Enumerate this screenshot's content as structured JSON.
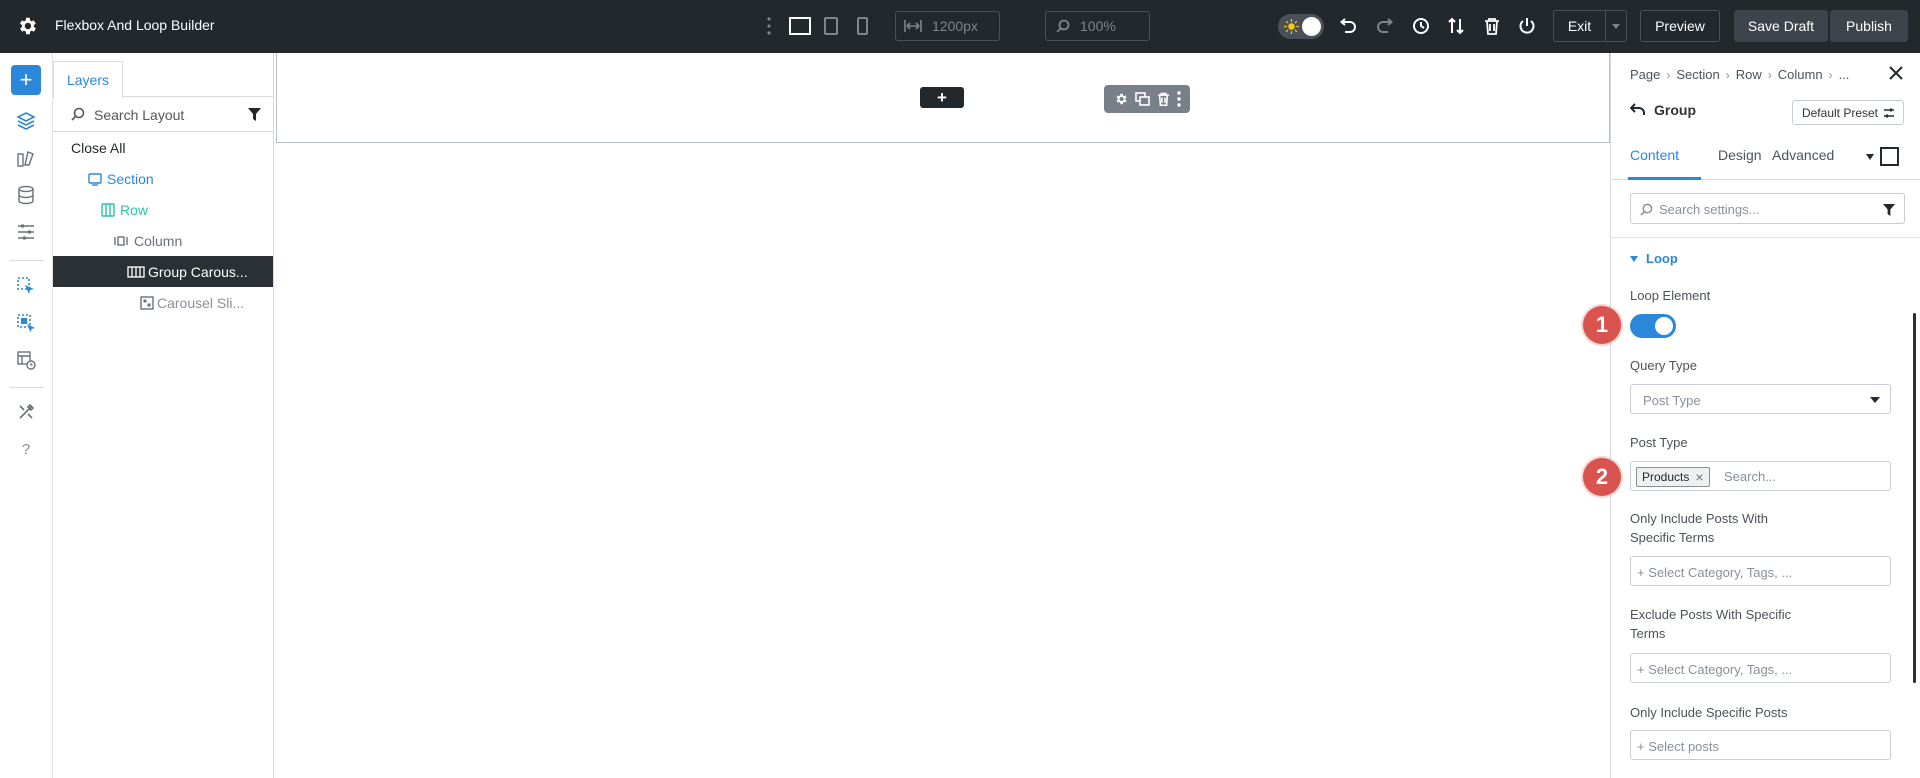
{
  "header": {
    "app_title": "Flexbox And Loop Builder",
    "width_value": "1200px",
    "zoom_value": "100%",
    "exit_label": "Exit",
    "preview_label": "Preview",
    "save_draft_label": "Save Draft",
    "publish_label": "Publish"
  },
  "layers_panel": {
    "tab_label": "Layers",
    "search_placeholder": "Search Layout",
    "close_all_label": "Close All",
    "items": [
      {
        "label": "Section",
        "color": "#2b87da"
      },
      {
        "label": "Row",
        "color": "#29c4a9"
      },
      {
        "label": "Column",
        "color": "#6b7177"
      },
      {
        "label": "Group Carous...",
        "color": "#ffffff"
      },
      {
        "label": "Carousel Sli...",
        "color": "#8a9097"
      }
    ]
  },
  "settings_panel": {
    "breadcrumbs": [
      "Page",
      "Row",
      "Column",
      "..."
    ],
    "breadcrumb_section": "Section",
    "element_title": "Group",
    "preset_label": "Default Preset",
    "tabs": [
      "Content",
      "Design",
      "Advanced"
    ],
    "search_placeholder": "Search settings...",
    "group_title": "Loop",
    "loop_element_label": "Loop Element",
    "loop_element_enabled": true,
    "query_type_label": "Query Type",
    "query_type_value": "Post Type",
    "post_type_label": "Post Type",
    "post_type_chip": "Products",
    "post_type_placeholder": "Search...",
    "include_terms_label": "Only Include Posts With Specific Terms",
    "include_terms_placeholder": "+ Select Category, Tags, ...",
    "exclude_terms_label": "Exclude Posts With Specific Terms",
    "exclude_terms_placeholder": "+ Select Category, Tags, ...",
    "include_posts_label": "Only Include Specific Posts",
    "include_posts_placeholder": "+ Select posts"
  },
  "annotations": [
    "1",
    "2"
  ],
  "colors": {
    "accent": "#2b87da",
    "topbar": "#23282d",
    "badge": "#d9534f"
  }
}
